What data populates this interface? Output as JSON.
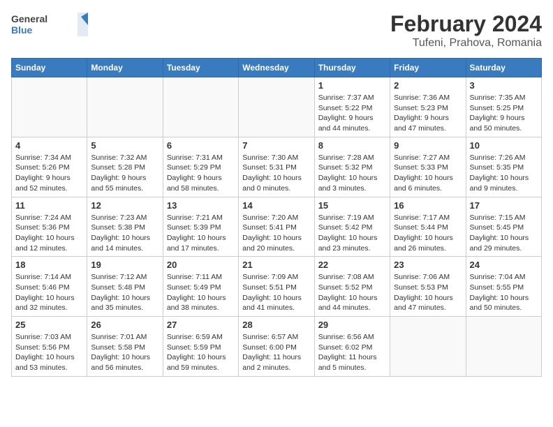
{
  "header": {
    "logo_general": "General",
    "logo_blue": "Blue",
    "month_title": "February 2024",
    "location": "Tufeni, Prahova, Romania"
  },
  "weekdays": [
    "Sunday",
    "Monday",
    "Tuesday",
    "Wednesday",
    "Thursday",
    "Friday",
    "Saturday"
  ],
  "weeks": [
    [
      {
        "day": "",
        "info": ""
      },
      {
        "day": "",
        "info": ""
      },
      {
        "day": "",
        "info": ""
      },
      {
        "day": "",
        "info": ""
      },
      {
        "day": "1",
        "info": "Sunrise: 7:37 AM\nSunset: 5:22 PM\nDaylight: 9 hours and 44 minutes."
      },
      {
        "day": "2",
        "info": "Sunrise: 7:36 AM\nSunset: 5:23 PM\nDaylight: 9 hours and 47 minutes."
      },
      {
        "day": "3",
        "info": "Sunrise: 7:35 AM\nSunset: 5:25 PM\nDaylight: 9 hours and 50 minutes."
      }
    ],
    [
      {
        "day": "4",
        "info": "Sunrise: 7:34 AM\nSunset: 5:26 PM\nDaylight: 9 hours and 52 minutes."
      },
      {
        "day": "5",
        "info": "Sunrise: 7:32 AM\nSunset: 5:28 PM\nDaylight: 9 hours and 55 minutes."
      },
      {
        "day": "6",
        "info": "Sunrise: 7:31 AM\nSunset: 5:29 PM\nDaylight: 9 hours and 58 minutes."
      },
      {
        "day": "7",
        "info": "Sunrise: 7:30 AM\nSunset: 5:31 PM\nDaylight: 10 hours and 0 minutes."
      },
      {
        "day": "8",
        "info": "Sunrise: 7:28 AM\nSunset: 5:32 PM\nDaylight: 10 hours and 3 minutes."
      },
      {
        "day": "9",
        "info": "Sunrise: 7:27 AM\nSunset: 5:33 PM\nDaylight: 10 hours and 6 minutes."
      },
      {
        "day": "10",
        "info": "Sunrise: 7:26 AM\nSunset: 5:35 PM\nDaylight: 10 hours and 9 minutes."
      }
    ],
    [
      {
        "day": "11",
        "info": "Sunrise: 7:24 AM\nSunset: 5:36 PM\nDaylight: 10 hours and 12 minutes."
      },
      {
        "day": "12",
        "info": "Sunrise: 7:23 AM\nSunset: 5:38 PM\nDaylight: 10 hours and 14 minutes."
      },
      {
        "day": "13",
        "info": "Sunrise: 7:21 AM\nSunset: 5:39 PM\nDaylight: 10 hours and 17 minutes."
      },
      {
        "day": "14",
        "info": "Sunrise: 7:20 AM\nSunset: 5:41 PM\nDaylight: 10 hours and 20 minutes."
      },
      {
        "day": "15",
        "info": "Sunrise: 7:19 AM\nSunset: 5:42 PM\nDaylight: 10 hours and 23 minutes."
      },
      {
        "day": "16",
        "info": "Sunrise: 7:17 AM\nSunset: 5:44 PM\nDaylight: 10 hours and 26 minutes."
      },
      {
        "day": "17",
        "info": "Sunrise: 7:15 AM\nSunset: 5:45 PM\nDaylight: 10 hours and 29 minutes."
      }
    ],
    [
      {
        "day": "18",
        "info": "Sunrise: 7:14 AM\nSunset: 5:46 PM\nDaylight: 10 hours and 32 minutes."
      },
      {
        "day": "19",
        "info": "Sunrise: 7:12 AM\nSunset: 5:48 PM\nDaylight: 10 hours and 35 minutes."
      },
      {
        "day": "20",
        "info": "Sunrise: 7:11 AM\nSunset: 5:49 PM\nDaylight: 10 hours and 38 minutes."
      },
      {
        "day": "21",
        "info": "Sunrise: 7:09 AM\nSunset: 5:51 PM\nDaylight: 10 hours and 41 minutes."
      },
      {
        "day": "22",
        "info": "Sunrise: 7:08 AM\nSunset: 5:52 PM\nDaylight: 10 hours and 44 minutes."
      },
      {
        "day": "23",
        "info": "Sunrise: 7:06 AM\nSunset: 5:53 PM\nDaylight: 10 hours and 47 minutes."
      },
      {
        "day": "24",
        "info": "Sunrise: 7:04 AM\nSunset: 5:55 PM\nDaylight: 10 hours and 50 minutes."
      }
    ],
    [
      {
        "day": "25",
        "info": "Sunrise: 7:03 AM\nSunset: 5:56 PM\nDaylight: 10 hours and 53 minutes."
      },
      {
        "day": "26",
        "info": "Sunrise: 7:01 AM\nSunset: 5:58 PM\nDaylight: 10 hours and 56 minutes."
      },
      {
        "day": "27",
        "info": "Sunrise: 6:59 AM\nSunset: 5:59 PM\nDaylight: 10 hours and 59 minutes."
      },
      {
        "day": "28",
        "info": "Sunrise: 6:57 AM\nSunset: 6:00 PM\nDaylight: 11 hours and 2 minutes."
      },
      {
        "day": "29",
        "info": "Sunrise: 6:56 AM\nSunset: 6:02 PM\nDaylight: 11 hours and 5 minutes."
      },
      {
        "day": "",
        "info": ""
      },
      {
        "day": "",
        "info": ""
      }
    ]
  ]
}
